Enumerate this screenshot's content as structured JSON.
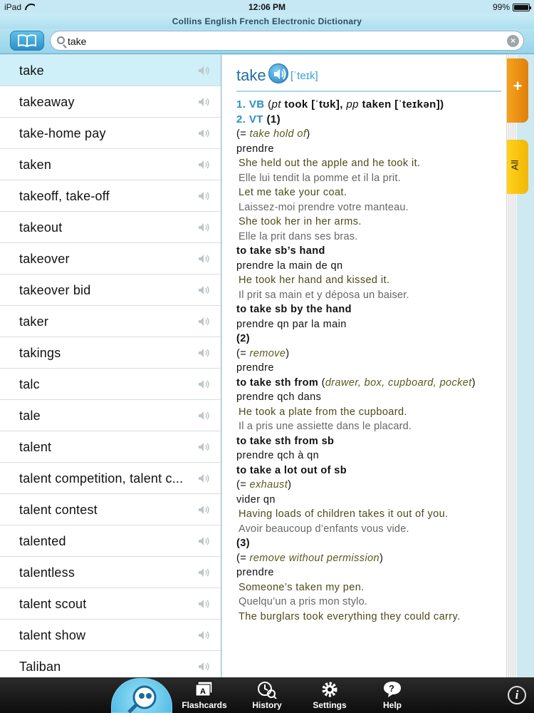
{
  "status_bar": {
    "device": "iPad",
    "time": "12:06 PM",
    "battery": "99%",
    "battery_level": 0.99
  },
  "app_title": "Collins English French Electronic Dictionary",
  "search": {
    "value": "take",
    "placeholder": ""
  },
  "word_list": [
    "take",
    "takeaway",
    "take-home pay",
    "taken",
    "takeoff, take-off",
    "takeout",
    "takeover",
    "takeover bid",
    "taker",
    "takings",
    "talc",
    "tale",
    "talent",
    "talent competition, talent c...",
    "talent contest",
    "talented",
    "talentless",
    "talent scout",
    "talent show",
    "Taliban"
  ],
  "selected_index": 0,
  "entry": {
    "headword": "take",
    "pronunciation": "[ˈteɪk]",
    "sense1": {
      "num": "1.",
      "pos": "VB",
      "open": "(",
      "pt": "pt",
      "pt_form": "took [ˈtʊk],",
      "pp": "pp",
      "pp_form": "taken [ˈteɪkən])"
    },
    "sense2": {
      "num": "2.",
      "pos": "VT",
      "sub": "(1)"
    },
    "l1": {
      "eq": "(= ",
      "gloss": "take hold of",
      "close": ")"
    },
    "l2": "prendre",
    "l3": "She held out the apple and he took it.",
    "l4": "Elle lui tendit la pomme et il la prit.",
    "l5": "Let me take your coat.",
    "l6": "Laissez-moi prendre votre manteau.",
    "l7": "She took her in her arms.",
    "l8": "Elle la prit dans ses bras.",
    "l9": "to take sb’s hand",
    "l10": "prendre la main de qn",
    "l11": "He took her hand and kissed it.",
    "l12": "Il prit sa main et y déposa un baiser.",
    "l13": "to take sb by the hand",
    "l14": "prendre qn par la main",
    "l15": "(2)",
    "l16": {
      "eq": "(= ",
      "gloss": "remove",
      "close": ")"
    },
    "l17": "prendre",
    "l18": {
      "phrase": "to take sth from",
      "open": " (",
      "gloss": "drawer, box, cupboard, pocket",
      "close": ")"
    },
    "l19": "prendre qch dans",
    "l20": "He took a plate from the cupboard.",
    "l21": "Il a pris une assiette dans le placard.",
    "l22": "to take sth from sb",
    "l23": "prendre qch à qn",
    "l24": "to take a lot out of sb",
    "l25": {
      "eq": "(= ",
      "gloss": "exhaust",
      "close": ")"
    },
    "l26": "vider qn",
    "l27": "Having loads of children takes it out of you.",
    "l28": "Avoir beaucoup d’enfants vous vide.",
    "l29": "(3)",
    "l30": {
      "eq": "(= ",
      "gloss": "remove without permission",
      "close": ")"
    },
    "l31": "prendre",
    "l32": "Someone’s taken my pen.",
    "l33": "Quelqu’un a pris mon stylo.",
    "l34": "The burglars took everything they could carry."
  },
  "side_tabs": {
    "add": "+",
    "all": "All"
  },
  "toolbar": {
    "flashcards": "Flashcards",
    "history": "History",
    "settings": "Settings",
    "help": "Help",
    "info": "i"
  },
  "colors": {
    "accent": "#2b8fc6",
    "selected_row": "#cfeff9",
    "tab_orange": "#f5a31d",
    "tab_yellow": "#ffd21c"
  }
}
